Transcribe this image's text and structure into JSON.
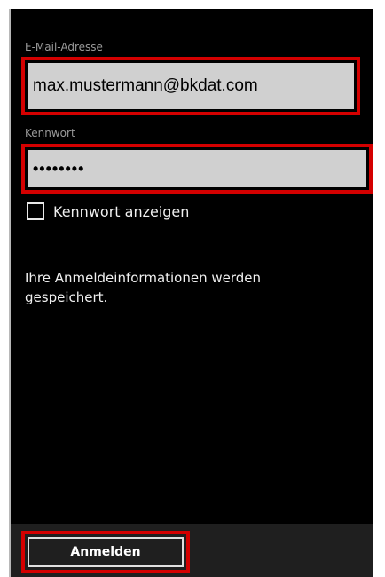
{
  "email": {
    "label": "E-Mail-Adresse",
    "value": "max.mustermann@bkdat.com"
  },
  "password": {
    "label": "Kennwort",
    "masked_value": "••••••••"
  },
  "show_password": {
    "label": "Kennwort anzeigen",
    "checked": false
  },
  "info_text": "Ihre Anmeldeinformationen werden gespeichert.",
  "app_bar": {
    "signin_label": "Anmelden"
  },
  "colors": {
    "highlight": "#d40000",
    "background": "#000000",
    "field": "#d0d0d0"
  }
}
